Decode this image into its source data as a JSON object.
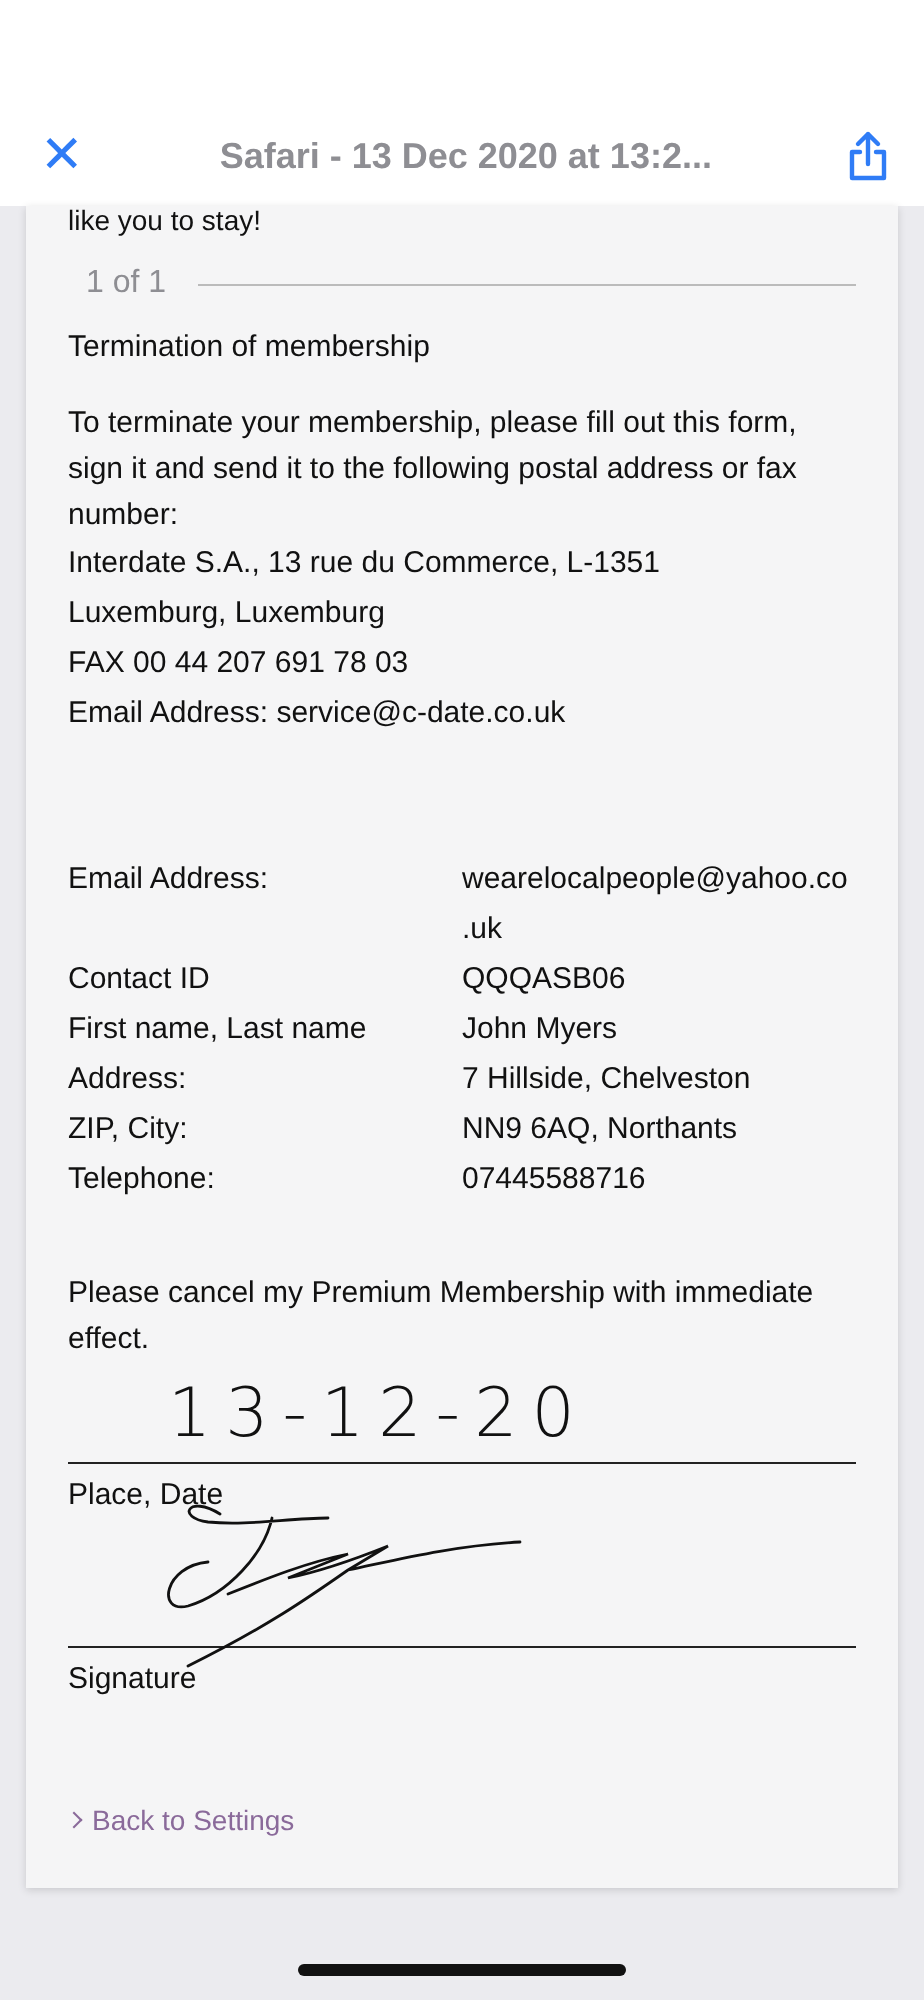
{
  "header": {
    "close_label": "✕",
    "title": "Safari - 13 Dec 2020 at 13:2..."
  },
  "document": {
    "cut_line": "like you to stay!",
    "page_counter": "1 of 1",
    "heading": "Termination of membership",
    "intro": "To terminate your membership, please fill out this form, sign it and send it to the following postal address or fax number:",
    "address_lines": [
      "Interdate S.A., 13 rue du Commerce, L-1351",
      "Luxemburg, Luxemburg",
      "FAX 00 44 207 691 78 03",
      "Email Address: service@c-date.co.uk"
    ],
    "details": [
      {
        "label": "Email Address:",
        "value": "wearelocalpeople@yahoo.co.uk"
      },
      {
        "label": "Contact ID",
        "value": "QQQASB06"
      },
      {
        "label": "First name, Last name",
        "value": "John Myers"
      },
      {
        "label": "Address:",
        "value": "7 Hillside, Chelveston"
      },
      {
        "label": "ZIP, City:",
        "value": "NN9 6AQ, Northants"
      },
      {
        "label": "Telephone:",
        "value": "07445588716"
      }
    ],
    "request": "Please cancel my Premium Membership with immediate effect.",
    "handwritten_date": "13-12-20",
    "date_caption": "Place, Date",
    "signature_caption": "Signature",
    "back_link": "Back to Settings"
  }
}
